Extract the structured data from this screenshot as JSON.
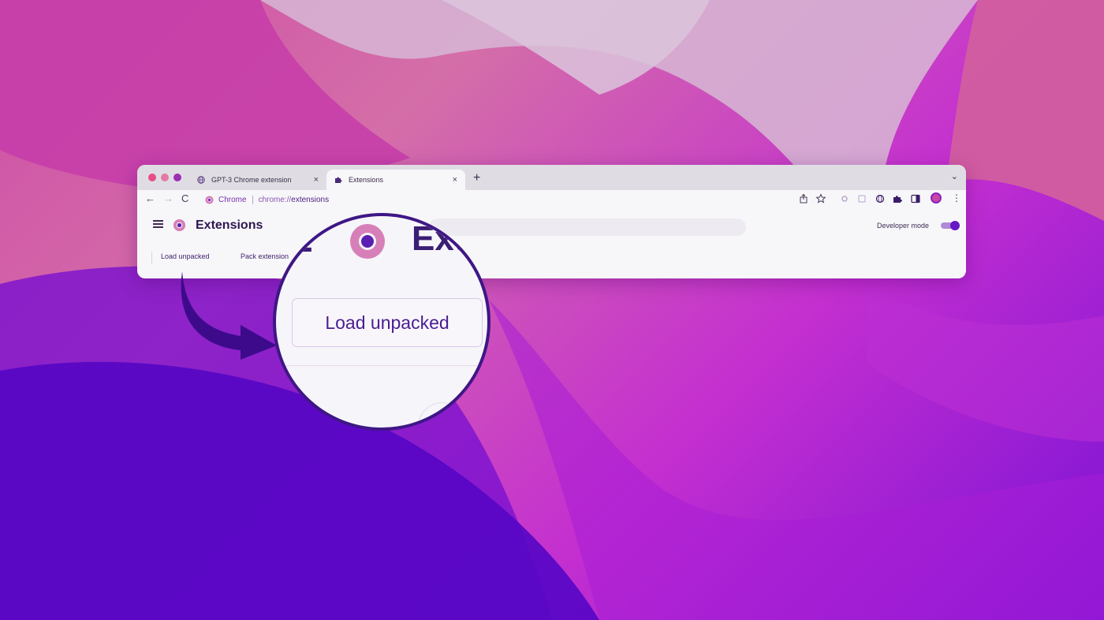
{
  "browser": {
    "tabs": [
      {
        "label": "GPT-3 Chrome extension",
        "icon": "globe-icon",
        "close": "×",
        "active": false
      },
      {
        "label": "Extensions",
        "icon": "puzzle-icon",
        "close": "×",
        "active": true
      }
    ],
    "new_tab": "+",
    "tab_menu": "⌄",
    "toolbar": {
      "back": "←",
      "forward": "→",
      "reload": "C",
      "site_name": "Chrome",
      "url_scheme": "chrome://",
      "url_path": "extensions",
      "menu": "⋮"
    }
  },
  "extensions_page": {
    "title": "Extensions",
    "developer_mode_label": "Developer mode",
    "developer_mode_on": true,
    "actions": {
      "load_unpacked": "Load unpacked",
      "pack_extension": "Pack extension"
    }
  },
  "magnifier": {
    "title_fragment_left": "E",
    "title_fragment_right": "Ext",
    "button_label": "Load unpacked"
  },
  "colors": {
    "accent": "#6518c4",
    "magnifier_border": "#3e1785",
    "arrow": "#3d0a8c"
  }
}
